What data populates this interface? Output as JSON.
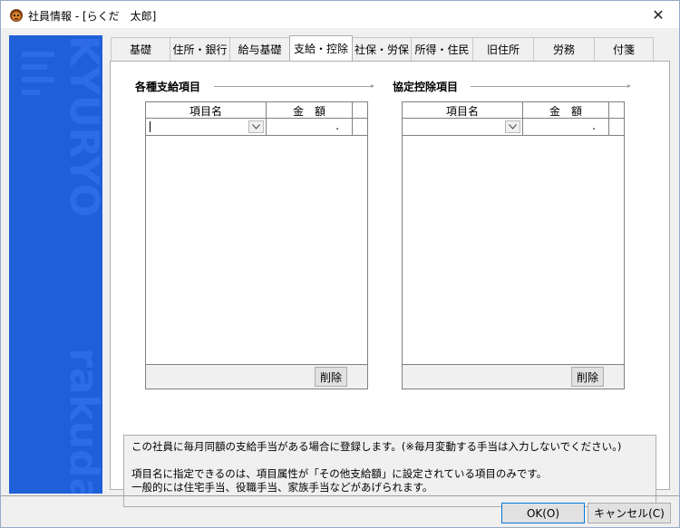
{
  "window": {
    "title": "社員情報 - [らくだ　太郎]",
    "close_glyph": "✕"
  },
  "brand": {
    "top_text": "KYURYO",
    "bottom_text": "rakuda",
    "color": "#1f5fd8"
  },
  "tabs": [
    {
      "label": "基礎",
      "active": false
    },
    {
      "label": "住所・銀行",
      "active": false
    },
    {
      "label": "給与基礎",
      "active": false
    },
    {
      "label": "支給・控除",
      "active": true
    },
    {
      "label": "社保・労保",
      "active": false
    },
    {
      "label": "所得・住民",
      "active": false
    },
    {
      "label": "旧住所",
      "active": false
    },
    {
      "label": "労務",
      "active": false
    },
    {
      "label": "付箋",
      "active": false
    }
  ],
  "allowance": {
    "group_label": "各種支給項目",
    "col_item": "項目名",
    "col_amount": "金　額",
    "amount_value": ".",
    "delete_label": "削除"
  },
  "deduction": {
    "group_label": "協定控除項目",
    "col_item": "項目名",
    "col_amount": "金　額",
    "amount_value": ".",
    "delete_label": "削除"
  },
  "note": {
    "line1": "この社員に毎月同額の支給手当がある場合に登録します。(※毎月変動する手当は入力しないでください。)",
    "line2": "項目名に指定できるのは、項目属性が「その他支給額」に設定されている項目のみです。",
    "line3": "一般的には住宅手当、役職手当、家族手当などがあげられます。"
  },
  "footer": {
    "ok_label": "OK(O)",
    "cancel_label": "キャンセル(C)"
  }
}
